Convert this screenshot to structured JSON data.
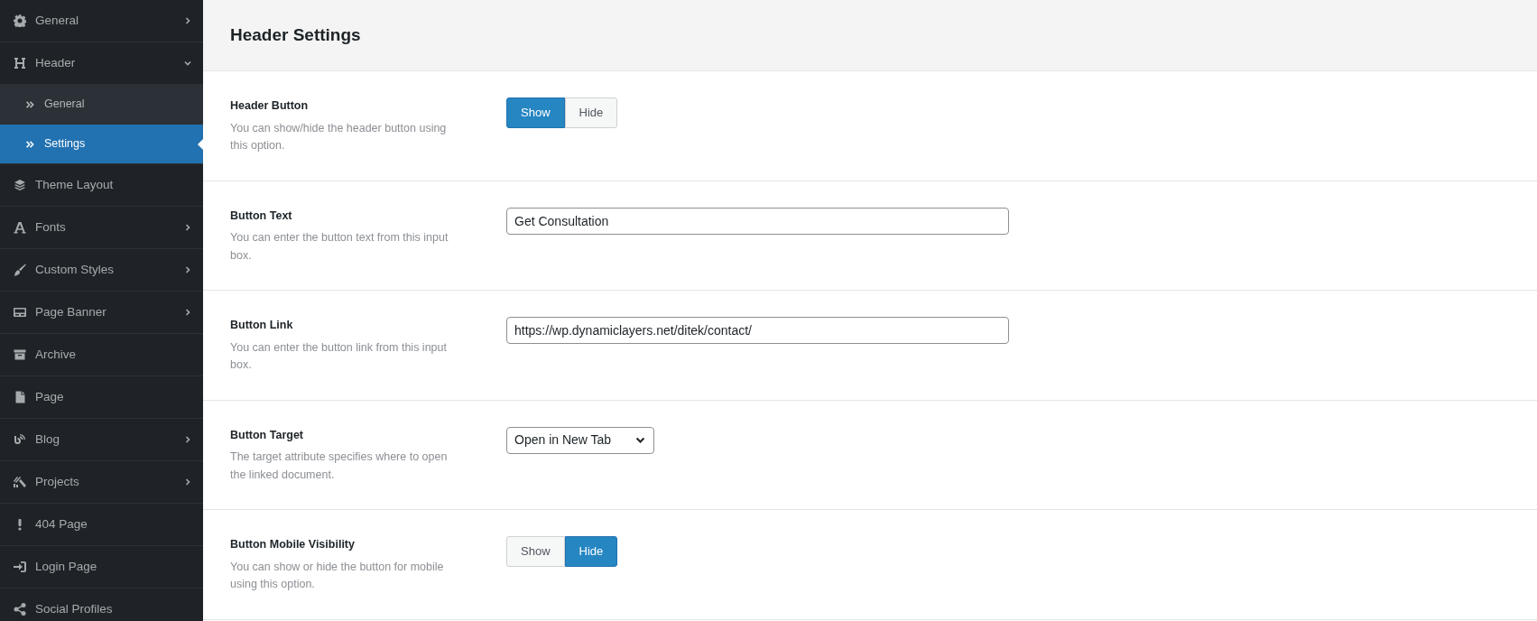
{
  "sidebar": {
    "items": [
      {
        "label": "General",
        "expanded": false,
        "selected": false
      },
      {
        "label": "Header",
        "expanded": true,
        "selected": false,
        "children": [
          {
            "label": "General",
            "selected": false
          },
          {
            "label": "Settings",
            "selected": true
          }
        ]
      },
      {
        "label": "Theme Layout",
        "selected": false
      },
      {
        "label": "Fonts",
        "expanded": false,
        "selected": false
      },
      {
        "label": "Custom Styles",
        "expanded": false,
        "selected": false
      },
      {
        "label": "Page Banner",
        "expanded": false,
        "selected": false
      },
      {
        "label": "Archive",
        "selected": false
      },
      {
        "label": "Page",
        "selected": false
      },
      {
        "label": "Blog",
        "expanded": false,
        "selected": false
      },
      {
        "label": "Projects",
        "expanded": false,
        "selected": false
      },
      {
        "label": "404 Page",
        "selected": false
      },
      {
        "label": "Login Page",
        "selected": false
      },
      {
        "label": "Social Profiles",
        "selected": false
      }
    ]
  },
  "page": {
    "title": "Header Settings",
    "settings": [
      {
        "kind": "toggle",
        "label": "Header Button",
        "description": "You can show/hide the header button using this option.",
        "options": [
          {
            "label": "Show",
            "selected": true
          },
          {
            "label": "Hide",
            "selected": false
          }
        ]
      },
      {
        "kind": "text",
        "label": "Button Text",
        "description": "You can enter the button text from this input box.",
        "value": "Get Consultation"
      },
      {
        "kind": "text",
        "label": "Button Link",
        "description": "You can enter the button link from this input box.",
        "value": "https://wp.dynamiclayers.net/ditek/contact/"
      },
      {
        "kind": "select",
        "label": "Button Target",
        "description": "The target attribute specifies where to open the linked document.",
        "value": "Open in New Tab"
      },
      {
        "kind": "toggle",
        "label": "Button Mobile Visibility",
        "description": "You can show or hide the button for mobile using this option.",
        "options": [
          {
            "label": "Show",
            "selected": false
          },
          {
            "label": "Hide",
            "selected": true
          }
        ]
      }
    ]
  }
}
